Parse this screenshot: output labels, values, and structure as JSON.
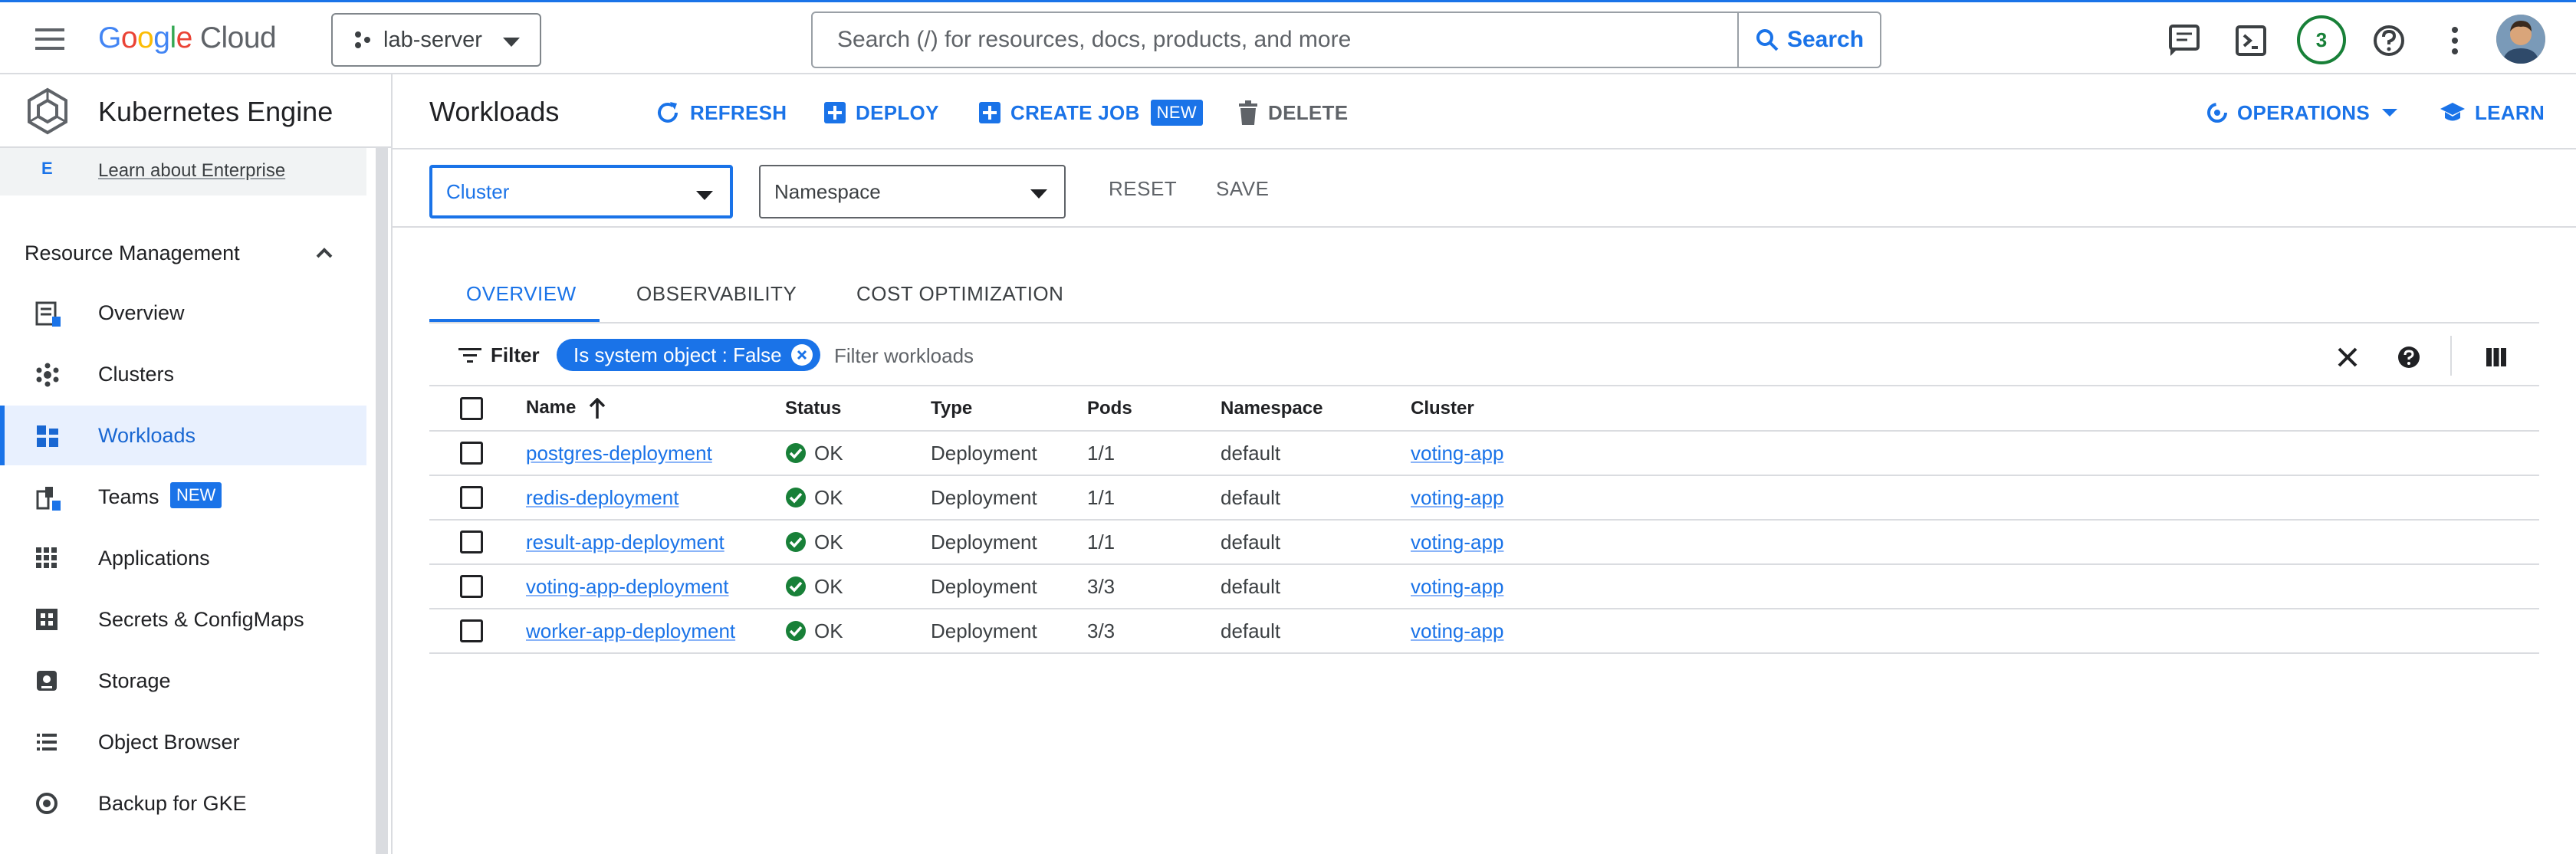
{
  "topbar": {
    "logo_google": [
      "G",
      "o",
      "o",
      "g",
      "l",
      "e"
    ],
    "logo_cloud": "Cloud",
    "project": "lab-server",
    "search_placeholder": "Search (/) for resources, docs, products, and more",
    "search_button": "Search",
    "notifications_count": "3",
    "accent_color": "#1a73e8"
  },
  "sidebar": {
    "product_title": "Kubernetes Engine",
    "enterprise_icon": "E",
    "enterprise_link": "Learn about Enterprise",
    "section_title": "Resource Management",
    "items": [
      {
        "label": "Overview",
        "icon": "overview-icon"
      },
      {
        "label": "Clusters",
        "icon": "clusters-icon"
      },
      {
        "label": "Workloads",
        "icon": "workloads-icon",
        "active": true
      },
      {
        "label": "Teams",
        "icon": "teams-icon",
        "badge": "NEW"
      },
      {
        "label": "Applications",
        "icon": "applications-icon"
      },
      {
        "label": "Secrets & ConfigMaps",
        "icon": "secrets-icon"
      },
      {
        "label": "Storage",
        "icon": "storage-icon"
      },
      {
        "label": "Object Browser",
        "icon": "object-browser-icon"
      },
      {
        "label": "Backup for GKE",
        "icon": "backup-icon"
      }
    ]
  },
  "header": {
    "title": "Workloads",
    "refresh": "REFRESH",
    "deploy": "DEPLOY",
    "create_job": "CREATE JOB",
    "create_job_badge": "NEW",
    "delete": "DELETE",
    "operations": "OPERATIONS",
    "learn": "LEARN"
  },
  "filters": {
    "cluster": "Cluster",
    "namespace": "Namespace",
    "reset": "RESET",
    "save": "SAVE"
  },
  "tabs": [
    "OVERVIEW",
    "OBSERVABILITY",
    "COST OPTIMIZATION"
  ],
  "toolbar": {
    "filter_label": "Filter",
    "chip": "Is system object : False",
    "filter_placeholder": "Filter workloads"
  },
  "table": {
    "columns": [
      "Name",
      "Status",
      "Type",
      "Pods",
      "Namespace",
      "Cluster"
    ],
    "rows": [
      {
        "name": "postgres-deployment",
        "status": "OK",
        "type": "Deployment",
        "pods": "1/1",
        "namespace": "default",
        "cluster": "voting-app"
      },
      {
        "name": "redis-deployment",
        "status": "OK",
        "type": "Deployment",
        "pods": "1/1",
        "namespace": "default",
        "cluster": "voting-app"
      },
      {
        "name": "result-app-deployment",
        "status": "OK",
        "type": "Deployment",
        "pods": "1/1",
        "namespace": "default",
        "cluster": "voting-app"
      },
      {
        "name": "voting-app-deployment",
        "status": "OK",
        "type": "Deployment",
        "pods": "3/3",
        "namespace": "default",
        "cluster": "voting-app"
      },
      {
        "name": "worker-app-deployment",
        "status": "OK",
        "type": "Deployment",
        "pods": "3/3",
        "namespace": "default",
        "cluster": "voting-app"
      }
    ]
  }
}
